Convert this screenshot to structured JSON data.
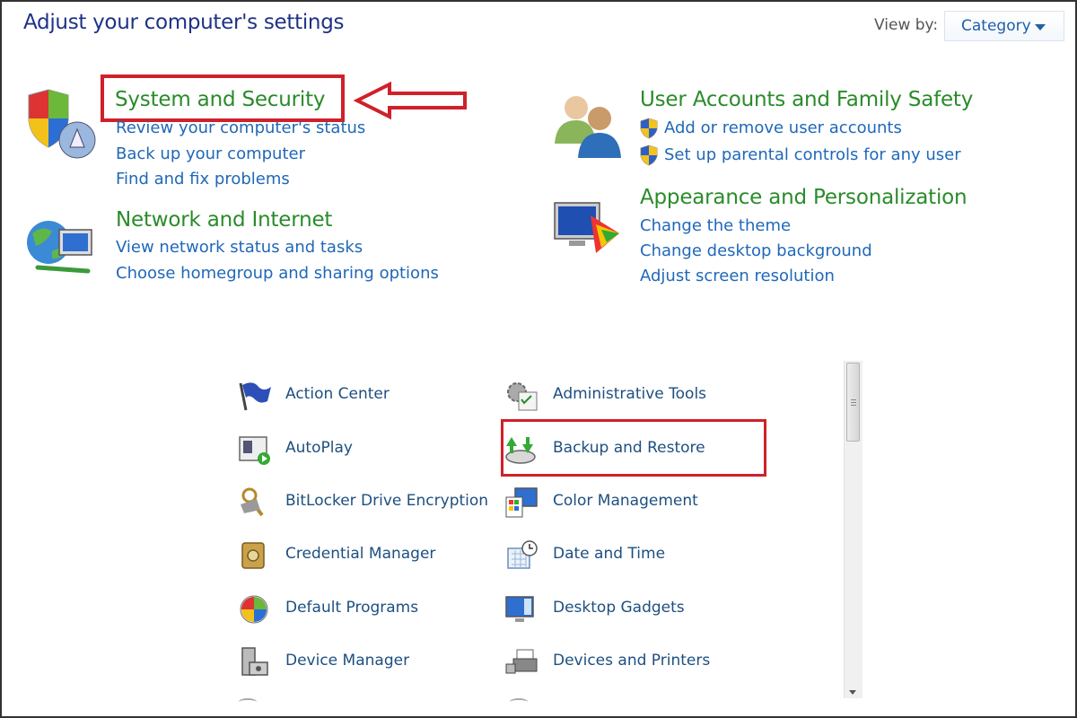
{
  "header": {
    "title": "Adjust your computer's settings",
    "view_by_label": "View by:",
    "view_by_value": "Category"
  },
  "categories": {
    "system_security": {
      "title": "System and Security",
      "links": [
        "Review your computer's status",
        "Back up your computer",
        "Find and fix problems"
      ]
    },
    "network": {
      "title": "Network and Internet",
      "links": [
        "View network status and tasks",
        "Choose homegroup and sharing options"
      ]
    },
    "user_accounts": {
      "title": "User Accounts and Family Safety",
      "links": [
        "Add or remove user accounts",
        "Set up parental controls for any user"
      ]
    },
    "appearance": {
      "title": "Appearance and Personalization",
      "links": [
        "Change the theme",
        "Change desktop background",
        "Adjust screen resolution"
      ]
    }
  },
  "items_left": [
    {
      "label": "Action Center",
      "icon": "flag-icon"
    },
    {
      "label": "AutoPlay",
      "icon": "autoplay-icon"
    },
    {
      "label": "BitLocker Drive Encryption",
      "icon": "bitlocker-keys-icon"
    },
    {
      "label": "Credential Manager",
      "icon": "vault-icon"
    },
    {
      "label": "Default Programs",
      "icon": "default-programs-icon"
    },
    {
      "label": "Device Manager",
      "icon": "device-manager-icon"
    }
  ],
  "items_right": [
    {
      "label": "Administrative Tools",
      "icon": "admin-tools-icon"
    },
    {
      "label": "Backup and Restore",
      "icon": "backup-icon"
    },
    {
      "label": "Color Management",
      "icon": "color-management-icon"
    },
    {
      "label": "Date and Time",
      "icon": "clock-calendar-icon"
    },
    {
      "label": "Desktop Gadgets",
      "icon": "gadgets-icon"
    },
    {
      "label": "Devices and Printers",
      "icon": "printer-icon"
    }
  ],
  "colors": {
    "category_title": "#2a8b2a",
    "link": "#2068b8",
    "highlight": "#d0202a"
  }
}
